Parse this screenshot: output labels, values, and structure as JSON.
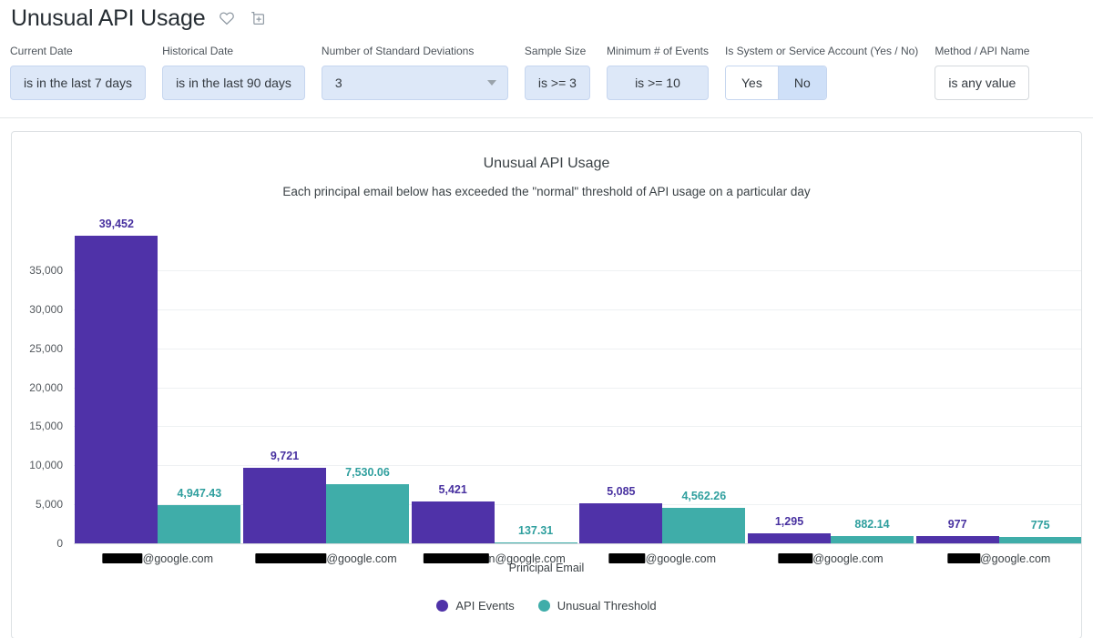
{
  "header": {
    "title": "Unusual API Usage",
    "favorite_icon": "heart-icon",
    "add_icon": "add-to-dashboard-icon"
  },
  "filters": [
    {
      "label": "Current Date",
      "value": "is in the last 7 days",
      "type": "chip"
    },
    {
      "label": "Historical Date",
      "value": "is in the last 90 days",
      "type": "chip"
    },
    {
      "label": "Number of Standard Deviations",
      "value": "3",
      "type": "dropdown"
    },
    {
      "label": "Sample Size",
      "value": "is >= 3",
      "type": "chip"
    },
    {
      "label": "Minimum # of Events",
      "value": "is >= 10",
      "type": "chip"
    },
    {
      "label": "Is System or Service Account (Yes / No)",
      "type": "toggle",
      "options": [
        "Yes",
        "No"
      ],
      "selected": "No"
    },
    {
      "label": "Method / API Name",
      "value": "is any value",
      "type": "chip-white"
    }
  ],
  "chart_data": {
    "type": "bar",
    "title": "Unusual API Usage",
    "subtitle": "Each principal email below has exceeded the \"normal\" threshold of API usage on a particular day",
    "xlabel": "Principal Email",
    "ylabel": "",
    "ylim": [
      0,
      35000
    ],
    "yticks": [
      0,
      5000,
      10000,
      15000,
      20000,
      25000,
      30000,
      35000
    ],
    "ytick_labels": [
      "0",
      "5,000",
      "10,000",
      "15,000",
      "20,000",
      "25,000",
      "30,000",
      "35,000"
    ],
    "grid": true,
    "legend_position": "bottom",
    "categories": [
      "████@google.com",
      "████████@google.com",
      "████████n@google.com",
      "████@google.com",
      "███@google.com",
      "███@google.com"
    ],
    "category_redact_widths": [
      44,
      78,
      72,
      40,
      38,
      36
    ],
    "category_suffixes": [
      "@google.com",
      "@google.com",
      "n@google.com",
      "@google.com",
      "@google.com",
      "@google.com"
    ],
    "series": [
      {
        "name": "API Events",
        "color": "#4f32a8",
        "values": [
          39452,
          9721,
          5421,
          5085,
          1295,
          977
        ],
        "labels": [
          "39,452",
          "9,721",
          "5,421",
          "5,085",
          "1,295",
          "977"
        ]
      },
      {
        "name": "Unusual Threshold",
        "color": "#3fada9",
        "values": [
          4947.43,
          7530.06,
          137.31,
          4562.26,
          882.14,
          775
        ],
        "labels": [
          "4,947.43",
          "7,530.06",
          "137.31",
          "4,562.26",
          "882.14",
          "775"
        ]
      }
    ]
  }
}
